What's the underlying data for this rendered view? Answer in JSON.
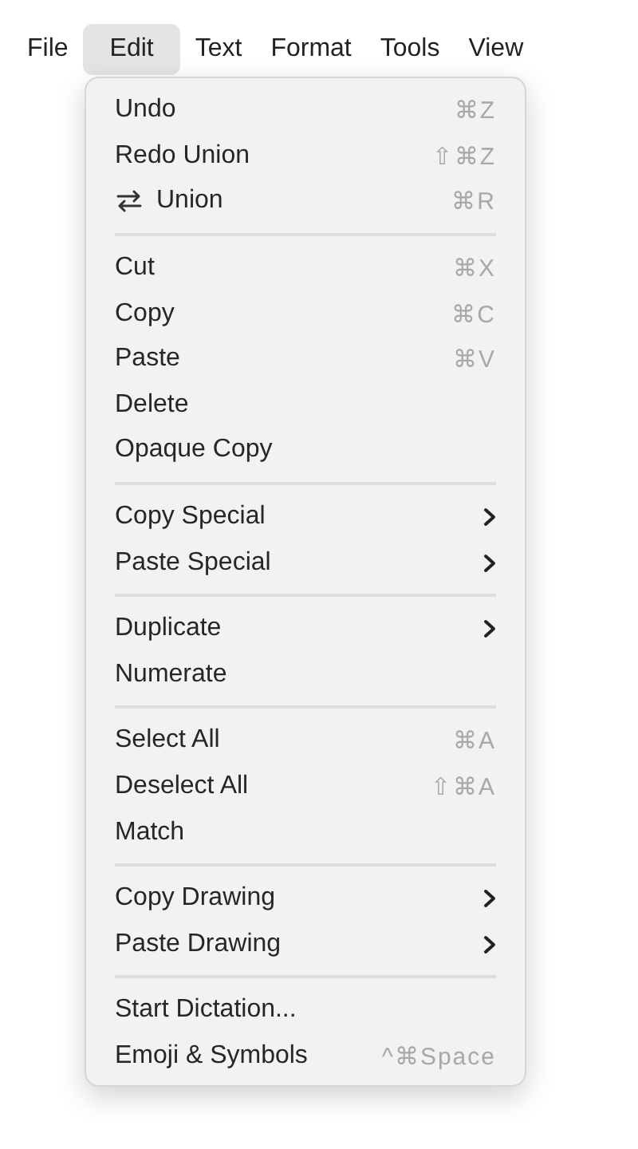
{
  "menubar": [
    {
      "label": "File",
      "selected": false
    },
    {
      "label": "Edit",
      "selected": true
    },
    {
      "label": "Text",
      "selected": false
    },
    {
      "label": "Format",
      "selected": false
    },
    {
      "label": "Tools",
      "selected": false
    },
    {
      "label": "View",
      "selected": false
    }
  ],
  "menu": {
    "groups": [
      {
        "items": [
          {
            "kind": "text",
            "label": "Undo",
            "shortcut": "⌘Z",
            "submenu": false
          },
          {
            "kind": "text",
            "label": "Redo Union",
            "shortcut": "⇧⌘Z",
            "submenu": false
          },
          {
            "kind": "swap-icon",
            "label": "Union",
            "shortcut": "⌘R",
            "submenu": false
          }
        ]
      },
      {
        "items": [
          {
            "kind": "text",
            "label": "Cut",
            "shortcut": "⌘X",
            "submenu": false
          },
          {
            "kind": "text",
            "label": "Copy",
            "shortcut": "⌘C",
            "submenu": false
          },
          {
            "kind": "text",
            "label": "Paste",
            "shortcut": "⌘V",
            "submenu": false
          },
          {
            "kind": "text",
            "label": "Delete",
            "submenu": false
          },
          {
            "kind": "text",
            "label": "Opaque Copy",
            "submenu": false
          }
        ]
      },
      {
        "items": [
          {
            "kind": "text",
            "label": "Copy Special",
            "submenu": true
          },
          {
            "kind": "text",
            "label": "Paste Special",
            "submenu": true
          }
        ]
      },
      {
        "items": [
          {
            "kind": "text",
            "label": "Duplicate",
            "submenu": true
          },
          {
            "kind": "text",
            "label": "Numerate",
            "submenu": false
          }
        ]
      },
      {
        "items": [
          {
            "kind": "text",
            "label": "Select All",
            "shortcut": "⌘A",
            "submenu": false
          },
          {
            "kind": "text",
            "label": "Deselect All",
            "shortcut": "⇧⌘A",
            "submenu": false
          },
          {
            "kind": "text",
            "label": "Match",
            "submenu": false
          }
        ]
      },
      {
        "items": [
          {
            "kind": "text",
            "label": "Copy Drawing",
            "submenu": true
          },
          {
            "kind": "text",
            "label": "Paste Drawing",
            "submenu": true
          }
        ]
      },
      {
        "items": [
          {
            "kind": "text",
            "label": "Start Dictation...",
            "submenu": false
          },
          {
            "kind": "text",
            "label": "Emoji & Symbols",
            "shortcut": "^⌘Space",
            "submenu": false
          }
        ]
      }
    ]
  }
}
